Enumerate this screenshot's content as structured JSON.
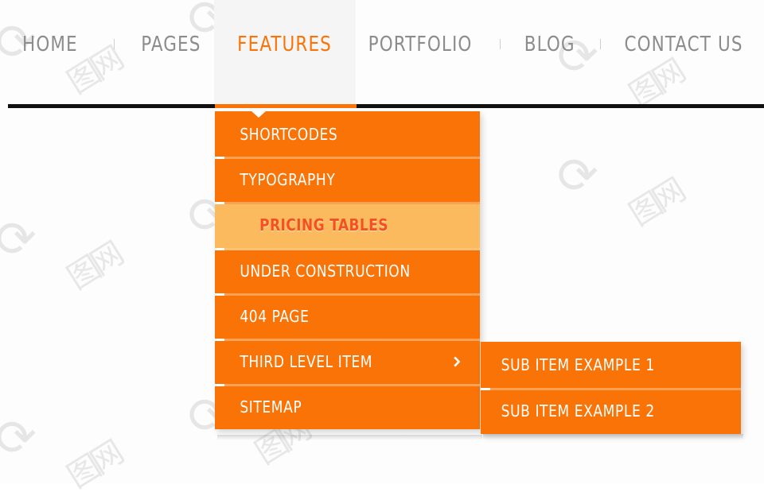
{
  "colors": {
    "accent_orange": "#f97306",
    "highlight_bg": "#fcba5e",
    "highlight_text": "#f4511e",
    "nav_text": "#8c8c8c",
    "nav_rule": "#111111",
    "active_tab_bg": "#f5f5f5",
    "menu_text": "#ffffff",
    "separator_light": "#fba155"
  },
  "navbar": {
    "items": [
      {
        "label": "HOME",
        "active": false
      },
      {
        "label": "PAGES",
        "active": false
      },
      {
        "label": "FEATURES",
        "active": true
      },
      {
        "label": "PORTFOLIO",
        "active": false
      },
      {
        "label": "BLOG",
        "active": false
      },
      {
        "label": "CONTACT US",
        "active": false
      }
    ]
  },
  "dropdown": {
    "parent": "FEATURES",
    "items": [
      {
        "label": "SHORTCODES",
        "highlight": false,
        "has_submenu": false
      },
      {
        "label": "TYPOGRAPHY",
        "highlight": false,
        "has_submenu": false
      },
      {
        "label": "PRICING TABLES",
        "highlight": true,
        "has_submenu": false
      },
      {
        "label": "UNDER CONSTRUCTION",
        "highlight": false,
        "has_submenu": false
      },
      {
        "label": "404 PAGE",
        "highlight": false,
        "has_submenu": false
      },
      {
        "label": "THIRD LEVEL ITEM",
        "highlight": false,
        "has_submenu": true
      },
      {
        "label": "SITEMAP",
        "highlight": false,
        "has_submenu": false
      }
    ]
  },
  "submenu": {
    "parent": "THIRD LEVEL ITEM",
    "items": [
      {
        "label": "SUB ITEM EXAMPLE 1"
      },
      {
        "label": "SUB ITEM EXAMPLE 2"
      }
    ]
  },
  "icons": {
    "submenu_arrow": "chevron-right-icon",
    "dropdown_notch": "caret-down-icon"
  },
  "watermark": {
    "spiral_glyph": "@",
    "cjk_glyph": "图",
    "text": "六图网"
  }
}
